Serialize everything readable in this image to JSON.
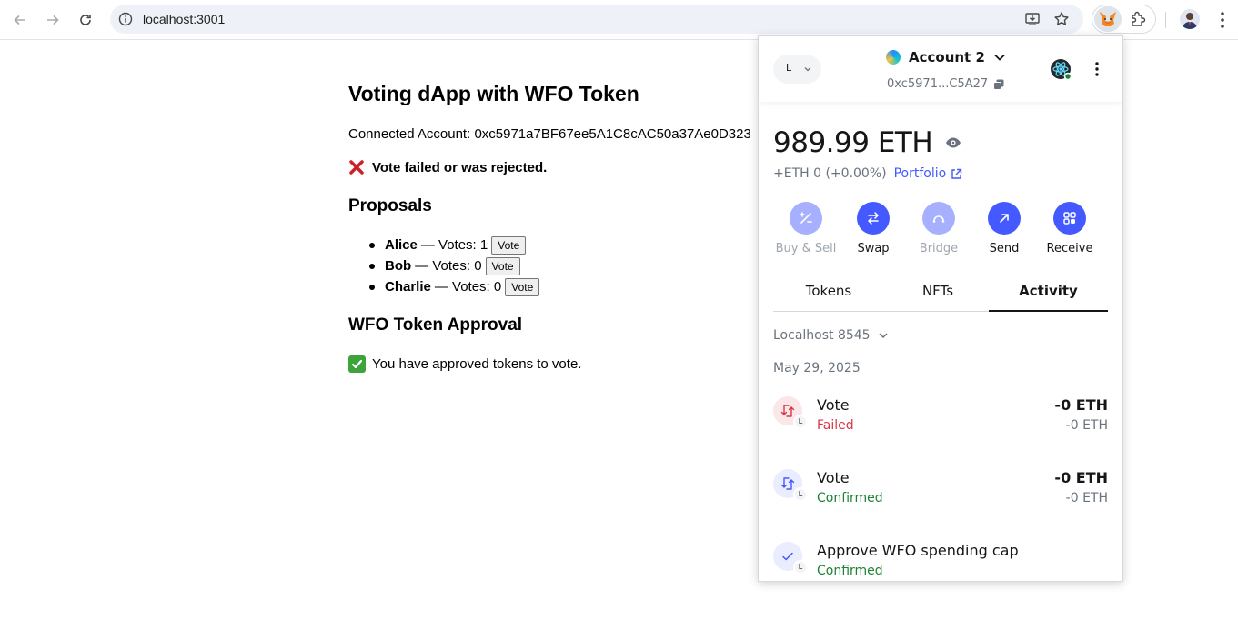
{
  "browser": {
    "url": "localhost:3001"
  },
  "page": {
    "title": "Voting dApp with WFO Token",
    "connected_label": "Connected Account: ",
    "connected_address": "0xc5971a7BF67ee5A1C8cAC50a37Ae0D323",
    "vote_status": "Vote failed or was rejected.",
    "proposals_heading": "Proposals",
    "proposals": [
      {
        "name": "Alice",
        "votes_text": "— Votes: 1",
        "button": "Vote"
      },
      {
        "name": "Bob",
        "votes_text": "— Votes: 0",
        "button": "Vote"
      },
      {
        "name": "Charlie",
        "votes_text": "— Votes: 0",
        "button": "Vote"
      }
    ],
    "approval_heading": "WFO Token Approval",
    "approval_status": "You have approved tokens to vote."
  },
  "wallet": {
    "network_letter": "L",
    "account_name": "Account 2",
    "address_short": "0xc5971...C5A27",
    "balance": "989.99 ETH",
    "change": "+ETH 0 (+0.00%)",
    "portfolio_link": "Portfolio",
    "actions": [
      {
        "label": "Buy & Sell",
        "icon": "buy-sell-icon",
        "disabled": true
      },
      {
        "label": "Swap",
        "icon": "swap-icon",
        "disabled": false
      },
      {
        "label": "Bridge",
        "icon": "bridge-icon",
        "disabled": true
      },
      {
        "label": "Send",
        "icon": "send-icon",
        "disabled": false
      },
      {
        "label": "Receive",
        "icon": "receive-icon",
        "disabled": false
      }
    ],
    "tabs": [
      {
        "label": "Tokens",
        "active": false
      },
      {
        "label": "NFTs",
        "active": false
      },
      {
        "label": "Activity",
        "active": true
      }
    ],
    "network_filter": "Localhost 8545",
    "activity_date": "May 29, 2025",
    "transactions": [
      {
        "title": "Vote",
        "status": "Failed",
        "amount": "-0 ETH",
        "amount_secondary": "-0 ETH",
        "badge": "L"
      },
      {
        "title": "Vote",
        "status": "Confirmed",
        "amount": "-0 ETH",
        "amount_secondary": "-0 ETH",
        "badge": "L"
      },
      {
        "title": "Approve WFO spending cap",
        "status": "Confirmed",
        "amount": "",
        "amount_secondary": "",
        "badge": "L"
      }
    ],
    "colors": {
      "primary": "#4459ff",
      "failed": "#d73847",
      "confirmed": "#1c8234"
    }
  }
}
